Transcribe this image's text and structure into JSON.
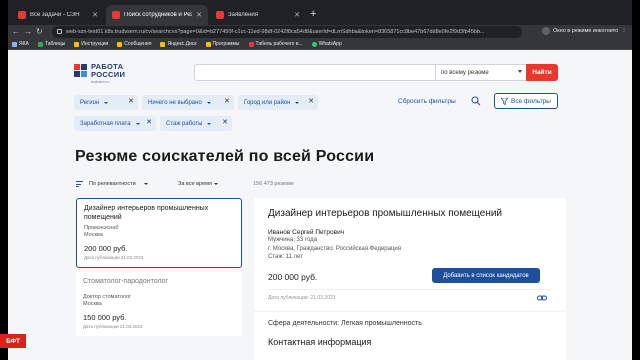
{
  "browser": {
    "tabs": [
      {
        "title": "Все задачи - СЭН",
        "color": "#e53935",
        "active": false
      },
      {
        "title": "Поиск сотрудников и Резюме с",
        "color": "#e53935",
        "active": true
      },
      {
        "title": "Заявления",
        "color": "#e53935",
        "active": false
      }
    ],
    "url": "web-szn-test01.k8s.trudvsem.ru/cv/searchcvs?page=0&id=b277450f-c1cc-11ed-98df-0242f8ca54d8&userId=dLmSdhba&token=8365871cc8be47b67dd8e0fe2f9d3fb45bb...",
    "incognito_label": "Окно в режиме инкогнито",
    "bookmarks": [
      "ЯКА",
      "Таблицы",
      "Инструкции",
      "Сообщения",
      "Яндекс.Диск",
      "Программы",
      "Табель рабочего в...",
      "WhatsApp"
    ]
  },
  "header": {
    "logo_line1": "РАБОТА",
    "logo_line2": "РОССИИ",
    "logo_sub": "trudvsem.ru",
    "search_placeholder": "",
    "scope": "по всему резюме",
    "search_button": "Найти"
  },
  "filters": {
    "chips_row1": [
      "Регион",
      "Ничего не выбрано",
      "Город или район"
    ],
    "chips_row2": [
      "Заработная плата",
      "Стаж работы"
    ],
    "reset": "Сбросить фильтры",
    "all_filters": "Все фильтры"
  },
  "main": {
    "heading": "Резюме соискателей по всей России",
    "sort_relevance": "По релевантности",
    "sort_time": "За все время",
    "count": "156 473 резюме"
  },
  "list": [
    {
      "title": "Дизайнер интерьеров промышленных помещений",
      "employer": "Промэнэснаб",
      "city": "Москва",
      "salary": "200 000 руб.",
      "date": "Дата публикации 21.03.2023"
    },
    {
      "title": "Стоматолог-пародонтолог",
      "employer": "Доктор стоматолог",
      "city": "Москва",
      "salary": "150 000 руб.",
      "date": "Дата публикации 21.03.2023"
    }
  ],
  "detail": {
    "title": "Дизайнер интерьеров промышленных помещений",
    "name": "Иванов Сергей Петрович",
    "gender_age": "Мужчина, 33 года",
    "location": "г. Москва, Гражданство: Российская Федерация",
    "experience": "Стаж: 11 лет",
    "salary": "200 000 руб.",
    "add_button": "Добавить в список кандидатов",
    "date": "Дата публикации: 21.03.2023",
    "sphere": "Сфера деятельности: Легкая промышленность",
    "contacts": "Контактная информация"
  },
  "badge": "БФТ",
  "colors": {
    "brand_blue": "#1f4e9c",
    "brand_red": "#e8372c",
    "chip_bg": "#e4ecf8"
  }
}
